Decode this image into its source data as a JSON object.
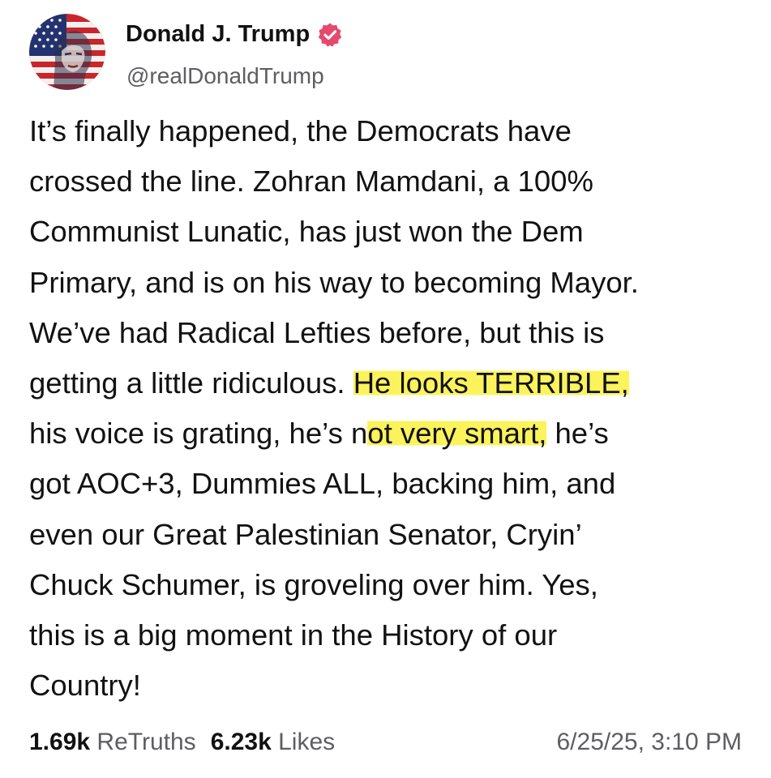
{
  "author": {
    "display_name": "Donald J. Trump",
    "handle": "@realDonaldTrump",
    "avatar_icon": "flag-portrait-avatar",
    "verified_icon": "verified-badge-icon",
    "verified_color": "#e5496d"
  },
  "post": {
    "lines": [
      {
        "text": "It’s finally happened, the Democrats have"
      },
      {
        "text": "crossed the line. Zohran Mamdani, a 100%"
      },
      {
        "text": "Communist Lunatic, has just won the Dem"
      },
      {
        "text": "Primary, and is on his way to becoming Mayor."
      },
      {
        "text": "We’ve had Radical Lefties before, but this is"
      },
      {
        "pre": "getting a little ridiculous. ",
        "hl": "He looks TERRIBLE,",
        "post": ""
      },
      {
        "pre": "his voice is grating, he’s n",
        "hl": "ot very smart,",
        "post": " he’s"
      },
      {
        "text": "got AOC+3, Dummies ALL, backing him, and"
      },
      {
        "text": "even our Great Palestinian Senator, Cryin’"
      },
      {
        "text": "Chuck Schumer, is groveling over him. Yes,"
      },
      {
        "text": "this is a big moment in the History of our"
      },
      {
        "text": "Country!"
      }
    ],
    "highlight_color": "#fbf35b"
  },
  "stats": {
    "retruths_count": "1.69k",
    "retruths_label": "ReTruths",
    "likes_count": "6.23k",
    "likes_label": "Likes",
    "timestamp": "6/25/25, 3:10 PM"
  }
}
